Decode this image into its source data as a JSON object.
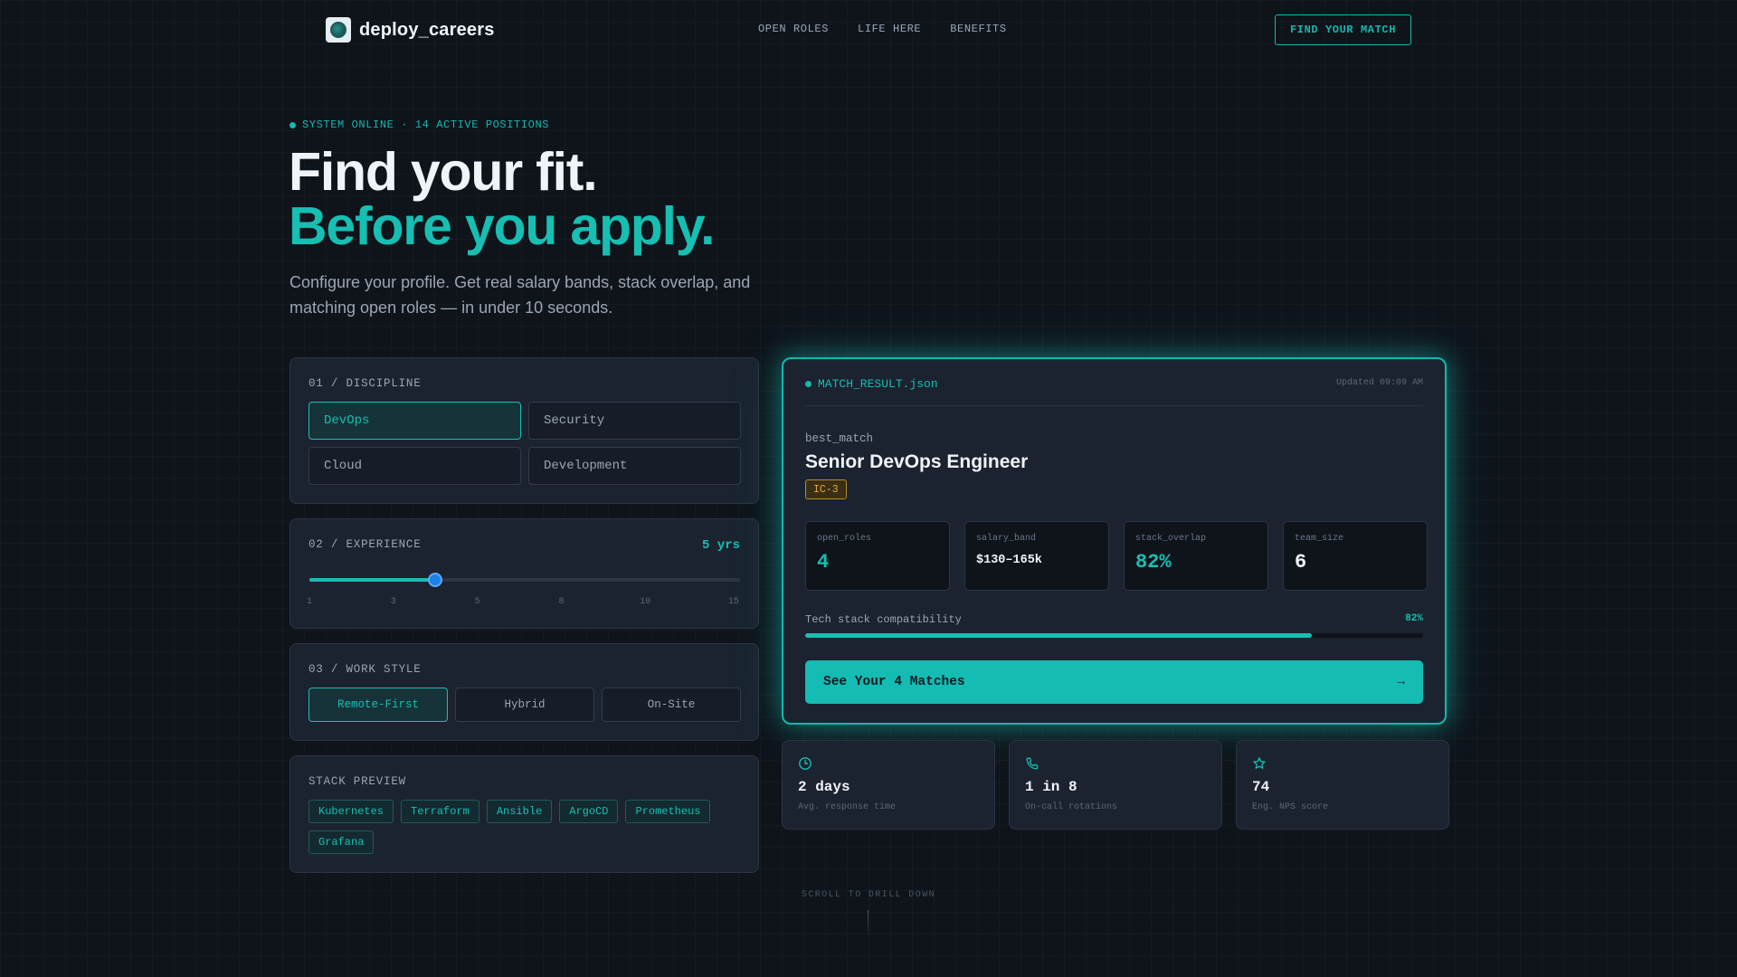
{
  "nav": {
    "brand": "deploy_careers",
    "links": [
      "OPEN ROLES",
      "LIFE HERE",
      "BENEFITS"
    ],
    "cta": "FIND YOUR MATCH"
  },
  "hero": {
    "status": "SYSTEM ONLINE · 14 ACTIVE POSITIONS",
    "title_line1": "Find your fit.",
    "title_line2": "Before you apply.",
    "subtitle": "Configure your profile. Get real salary bands, stack overlap, and matching open roles — in under 10 seconds."
  },
  "discipline": {
    "label": "01 / DISCIPLINE",
    "options": [
      "DevOps",
      "Security",
      "Cloud",
      "Development"
    ],
    "selected": "DevOps"
  },
  "experience": {
    "label": "02 / EXPERIENCE",
    "value_label": "5 yrs",
    "value": 5,
    "min": 1,
    "max": 15,
    "ticks": [
      "1",
      "3",
      "5",
      "8",
      "10",
      "15"
    ]
  },
  "work_style": {
    "label": "03 / WORK STYLE",
    "options": [
      "Remote-First",
      "Hybrid",
      "On-Site"
    ],
    "selected": "Remote-First"
  },
  "stack_preview": {
    "label": "STACK PREVIEW",
    "tags": [
      "Kubernetes",
      "Terraform",
      "Ansible",
      "ArgoCD",
      "Prometheus",
      "Grafana"
    ]
  },
  "result": {
    "file": "MATCH_RESULT.json",
    "updated": "Updated 09:09 AM",
    "best_match_label": "best_match",
    "title": "Senior DevOps Engineer",
    "level": "IC-3",
    "stats": [
      {
        "key": "open_roles",
        "value": "4"
      },
      {
        "key": "salary_band",
        "value": "$130–165k"
      },
      {
        "key": "stack_overlap",
        "value": "82%"
      },
      {
        "key": "team_size",
        "value": "6"
      }
    ],
    "compat_label": "Tech stack compatibility",
    "compat_value": "82%",
    "compat_fraction": 0.82,
    "cta": "See Your 4 Matches",
    "cta_arrow": "→"
  },
  "mini_stats": [
    {
      "icon": "clock-icon",
      "value": "2 days",
      "label": "Avg. response time"
    },
    {
      "icon": "phone-icon",
      "value": "1 in 8",
      "label": "On-call rotations"
    },
    {
      "icon": "star-icon",
      "value": "74",
      "label": "Eng. NPS score"
    }
  ],
  "scroll_hint": "SCROLL TO DRILL DOWN",
  "colors": {
    "background": "#0f141b",
    "panel": "#1b2330",
    "accent": "#16bfb2",
    "thumb": "#1f7fe6",
    "level_badge": "#e0a93a"
  }
}
